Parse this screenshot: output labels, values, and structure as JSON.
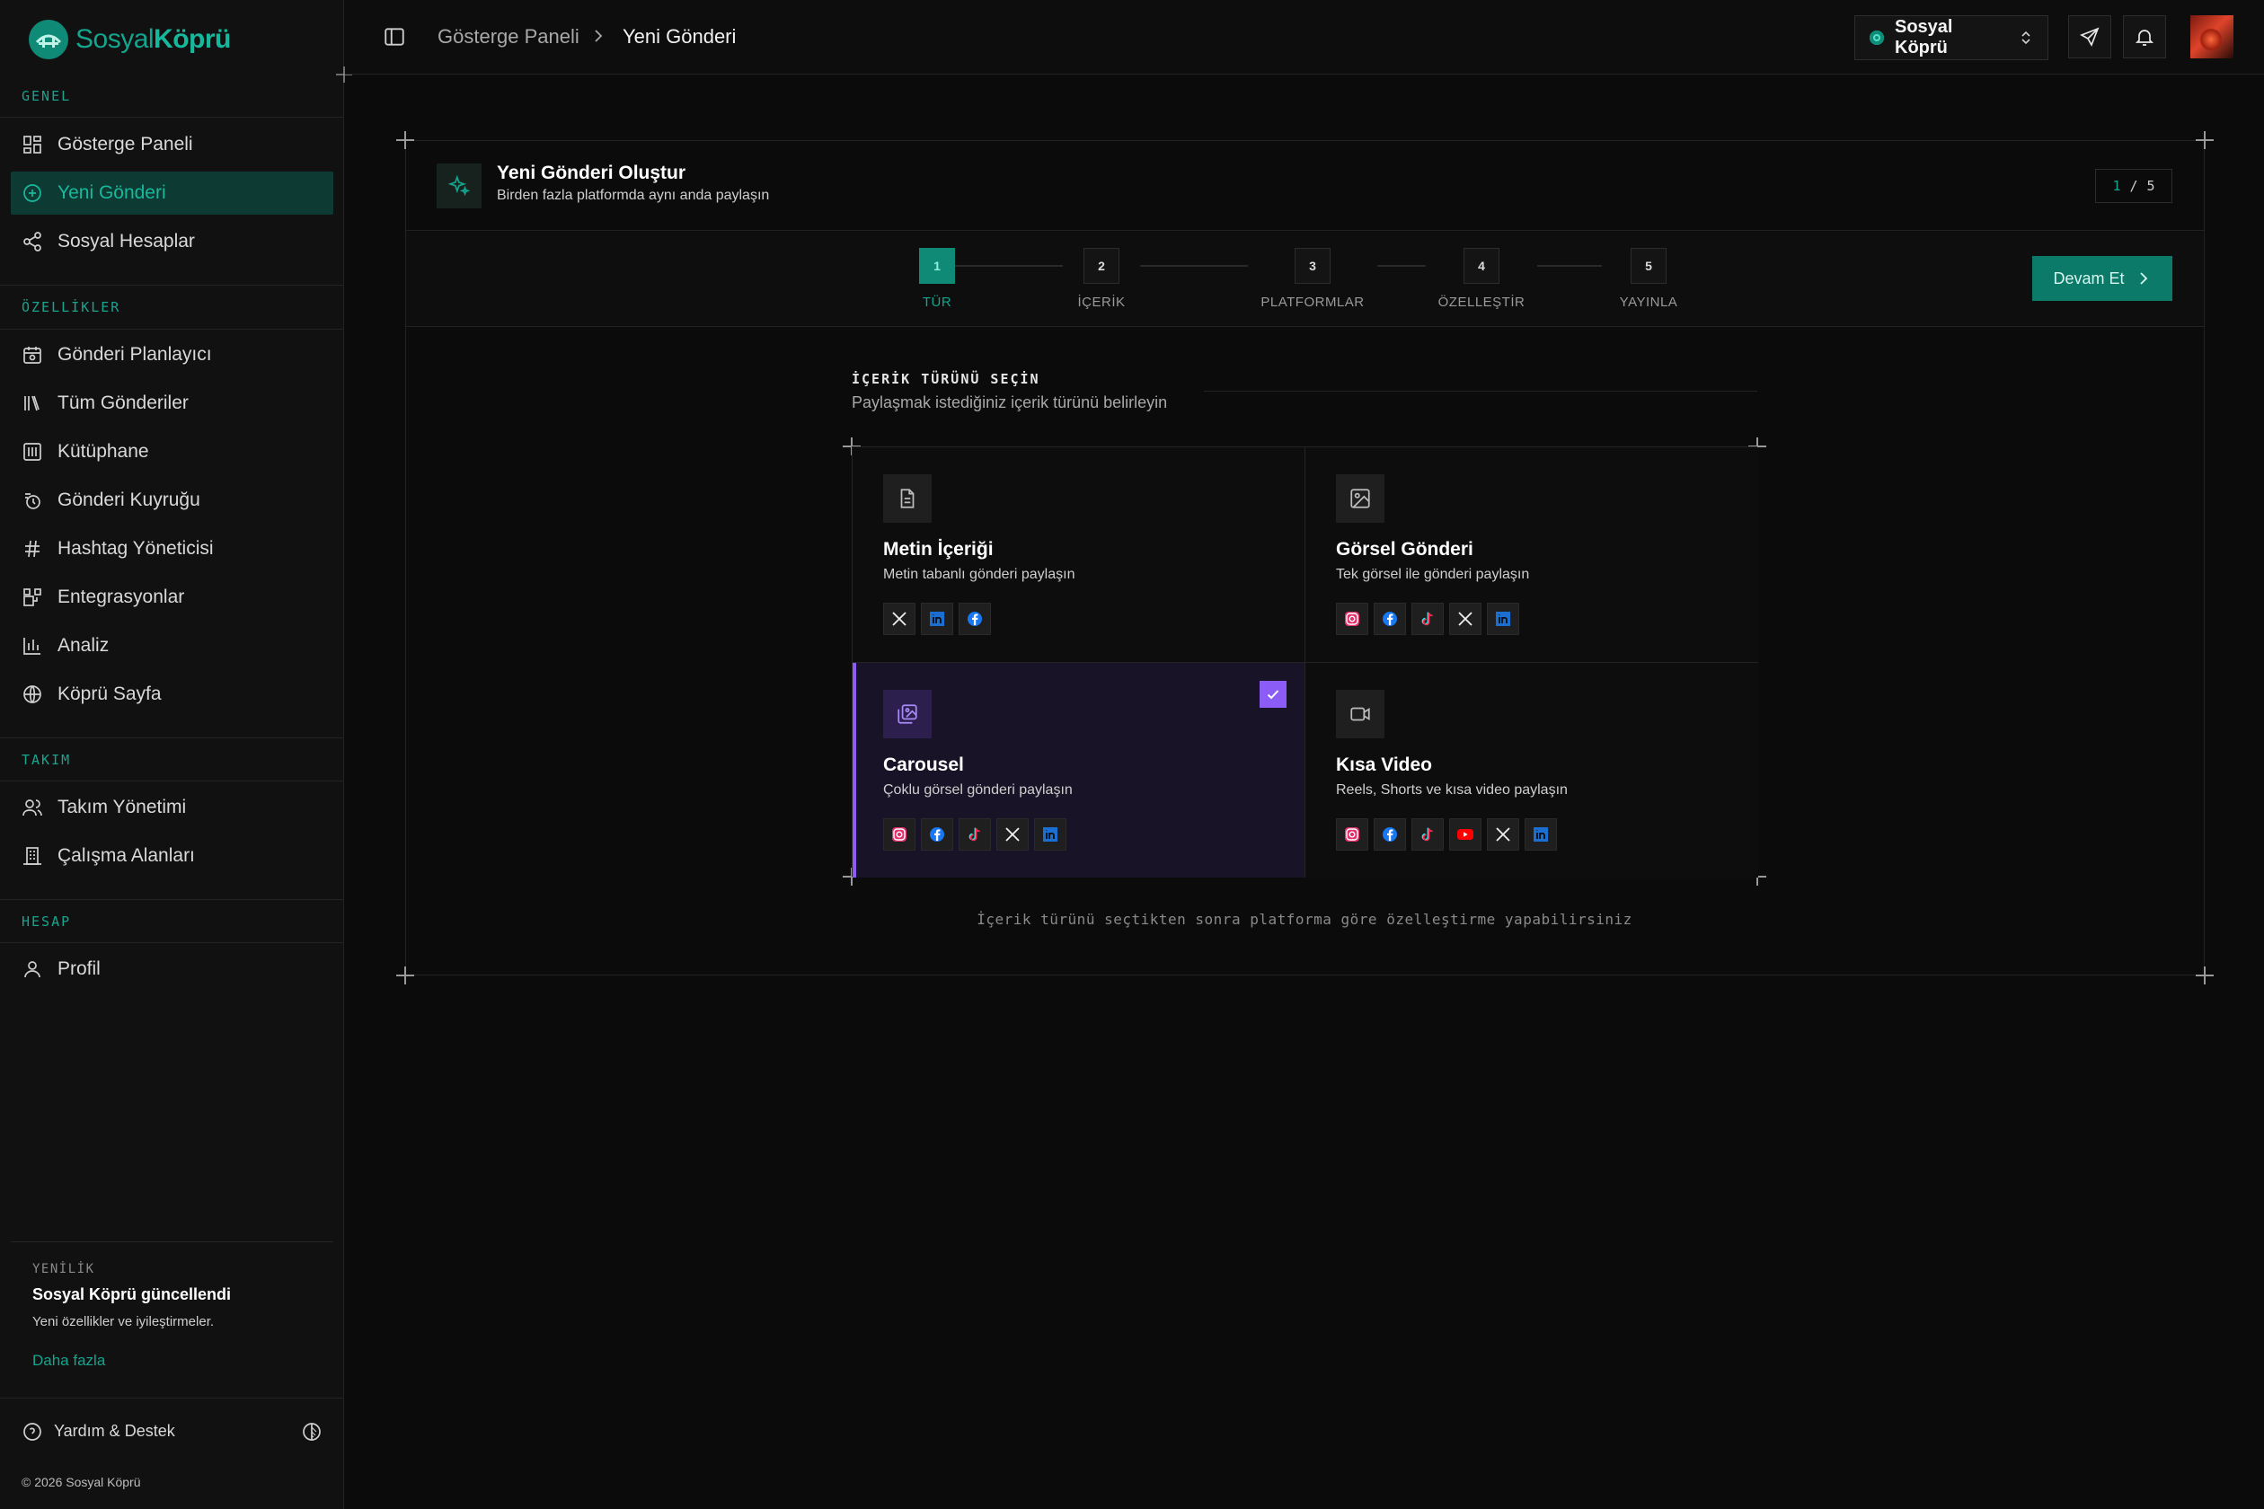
{
  "brand": {
    "name_light": "Sosyal",
    "name_bold": "Köprü"
  },
  "sidebar": {
    "sections": [
      {
        "label": "GENEL"
      },
      {
        "label": "ÖZELLİKLER"
      },
      {
        "label": "TAKIM"
      },
      {
        "label": "HESAP"
      }
    ],
    "items": [
      {
        "label": "Gösterge Paneli",
        "icon": "dashboard-icon"
      },
      {
        "label": "Yeni Gönderi",
        "icon": "plus-circle-icon",
        "active": true
      },
      {
        "label": "Sosyal Hesaplar",
        "icon": "share-icon"
      },
      {
        "label": "Gönderi Planlayıcı",
        "icon": "calendar-icon"
      },
      {
        "label": "Tüm Gönderiler",
        "icon": "library-icon"
      },
      {
        "label": "Kütüphane",
        "icon": "archive-icon"
      },
      {
        "label": "Gönderi Kuyruğu",
        "icon": "queue-icon"
      },
      {
        "label": "Hashtag Yöneticisi",
        "icon": "hash-icon"
      },
      {
        "label": "Entegrasyonlar",
        "icon": "integrations-icon"
      },
      {
        "label": "Analiz",
        "icon": "chart-icon"
      },
      {
        "label": "Köprü Sayfa",
        "icon": "globe-icon"
      },
      {
        "label": "Takım Yönetimi",
        "icon": "users-icon"
      },
      {
        "label": "Çalışma Alanları",
        "icon": "building-icon"
      },
      {
        "label": "Profil",
        "icon": "user-icon"
      }
    ],
    "news": {
      "tag": "YENİLİK",
      "title": "Sosyal Köprü güncellendi",
      "desc": "Yeni özellikler ve iyileştirmeler.",
      "link": "Daha fazla"
    },
    "help": "Yardım & Destek",
    "copyright": "© 2026 Sosyal Köprü"
  },
  "topbar": {
    "breadcrumb": [
      "Gösterge Paneli",
      "Yeni Gönderi"
    ],
    "workspace": "Sosyal Köprü"
  },
  "composer": {
    "title": "Yeni Gönderi Oluştur",
    "subtitle": "Birden fazla platformda aynı anda paylaşın",
    "step_current": "1",
    "step_sep": "/",
    "step_total": "5",
    "steps": [
      {
        "num": "1",
        "label": "TÜR"
      },
      {
        "num": "2",
        "label": "İÇERİK"
      },
      {
        "num": "3",
        "label": "PLATFORMLAR"
      },
      {
        "num": "4",
        "label": "ÖZELLEŞTİR"
      },
      {
        "num": "5",
        "label": "YAYINLA"
      }
    ],
    "next_label": "Devam Et",
    "type_heading": "İÇERİK TÜRÜNÜ SEÇİN",
    "type_sub": "Paylaşmak istediğiniz içerik türünü belirleyin",
    "types": [
      {
        "title": "Metin İçeriği",
        "desc": "Metin tabanlı gönderi paylaşın",
        "icon": "file-text-icon",
        "platforms": [
          "x",
          "linkedin",
          "facebook"
        ]
      },
      {
        "title": "Görsel Gönderi",
        "desc": "Tek görsel ile gönderi paylaşın",
        "icon": "image-icon",
        "platforms": [
          "instagram",
          "facebook",
          "tiktok",
          "x",
          "linkedin"
        ]
      },
      {
        "title": "Carousel",
        "desc": "Çoklu görsel gönderi paylaşın",
        "icon": "images-icon",
        "selected": true,
        "platforms": [
          "instagram",
          "facebook",
          "tiktok",
          "x",
          "linkedin"
        ]
      },
      {
        "title": "Kısa Video",
        "desc": "Reels, Shorts ve kısa video paylaşın",
        "icon": "video-icon",
        "platforms": [
          "instagram",
          "facebook",
          "tiktok",
          "youtube",
          "x",
          "linkedin"
        ]
      }
    ],
    "footnote": "İçerik türünü seçtikten sonra platforma göre özelleştirme yapabilirsiniz"
  },
  "colors": {
    "accent": "#13a58d",
    "accent_dark": "#0c7a68",
    "selected": "#8b5cf6",
    "background": "#0b0b0b"
  }
}
